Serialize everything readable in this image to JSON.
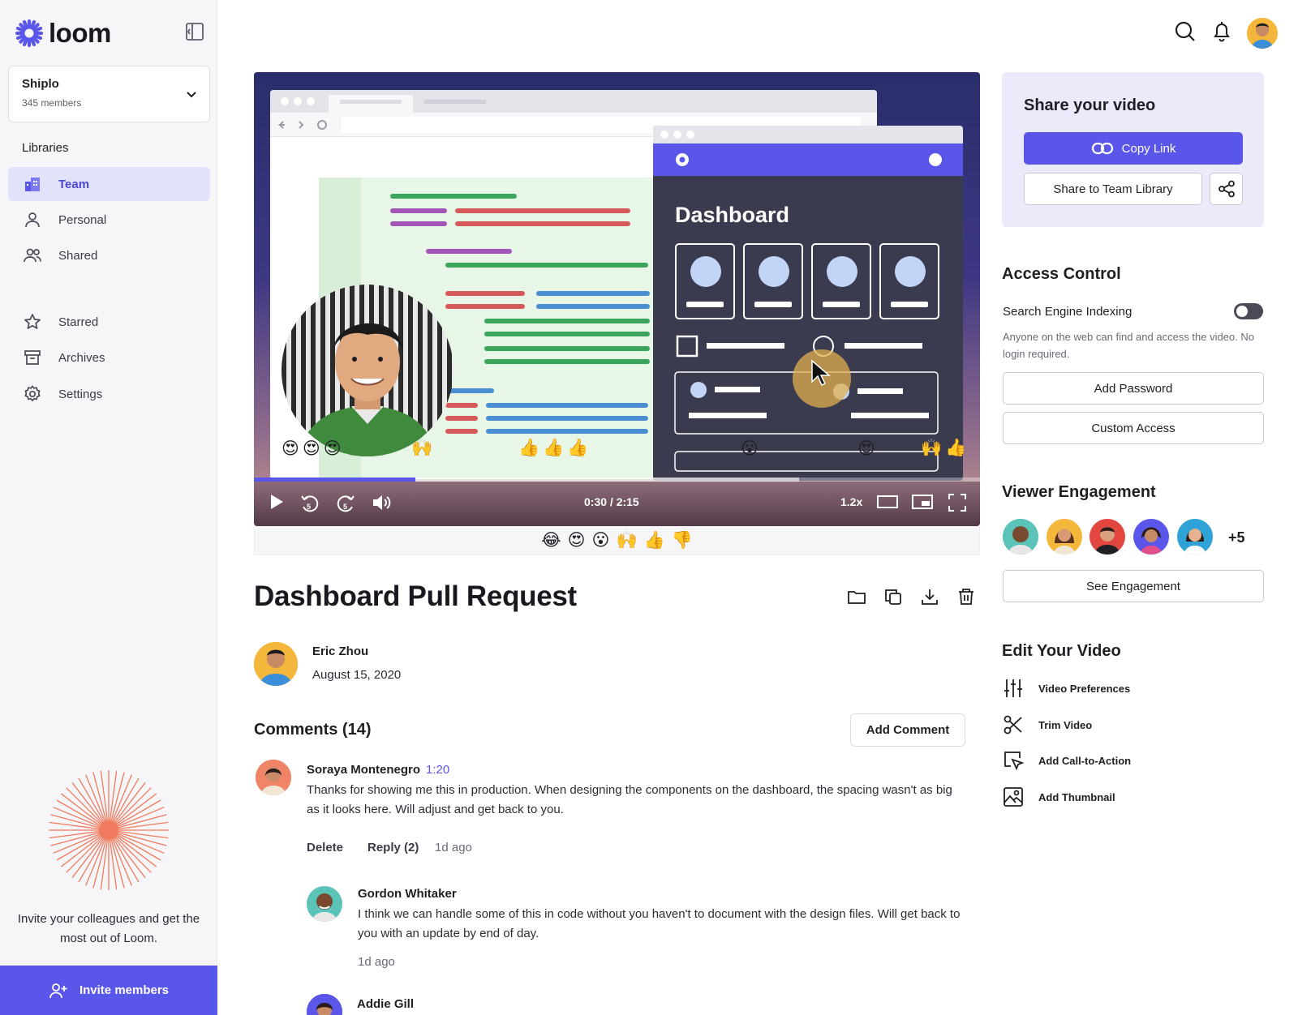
{
  "app": {
    "logo_text": "loom"
  },
  "workspace": {
    "name": "Shiplo",
    "members": "345 members"
  },
  "sidebar": {
    "libraries_heading": "Libraries",
    "items": [
      {
        "label": "Team",
        "icon": "team-icon",
        "active": true
      },
      {
        "label": "Personal",
        "icon": "person-icon",
        "active": false
      },
      {
        "label": "Shared",
        "icon": "people-icon",
        "active": false
      },
      {
        "label": "Starred",
        "icon": "star-icon",
        "active": false
      },
      {
        "label": "Archives",
        "icon": "archive-icon",
        "active": false
      },
      {
        "label": "Settings",
        "icon": "gear-icon",
        "active": false
      }
    ],
    "promo_text": "Invite your colleagues and get the most out of Loom.",
    "invite_label": "Invite members"
  },
  "video": {
    "current_time": "0:30",
    "duration": "2:15",
    "time_display": "0:30  /  2:15",
    "progress_fraction": 0.222,
    "speed": "1.2x",
    "screen_title": "Dashboard",
    "emojis_left": "😍😍😍",
    "emojis_mid": "🙌",
    "emojis_thumbs": "👍👍👍",
    "emojis_bar": "😮",
    "emojis_bar_right": "😍",
    "emojis_right": "🙌👍",
    "reactions": [
      "😂",
      "😍",
      "😮",
      "🙌",
      "👍",
      "👎"
    ]
  },
  "title": "Dashboard Pull Request",
  "author": {
    "name": "Eric Zhou",
    "date": "August 15, 2020"
  },
  "comments": {
    "heading": "Comments (14)",
    "add_label": "Add Comment",
    "items": [
      {
        "name": "Soraya Montenegro",
        "timestamp": "1:20",
        "body": "Thanks for showing me this in production. When designing the components on the dashboard, the spacing wasn't as big as it looks here. Will adjust and get back to you.",
        "delete_label": "Delete",
        "reply_label": "Reply (2)",
        "ago": "1d ago"
      },
      {
        "name": "Gordon Whitaker",
        "body": "I think we can handle some of this in code without you haven't to document with the design files. Will get back to you with an update by end of day.",
        "ago": "1d ago"
      },
      {
        "name": "Addie Gill"
      }
    ]
  },
  "share": {
    "title": "Share your video",
    "copy_link": "Copy Link",
    "share_team": "Share to Team Library"
  },
  "access": {
    "title": "Access Control",
    "seo_label": "Search Engine Indexing",
    "seo_enabled": false,
    "seo_desc": "Anyone on the web can find and access the video. No login required.",
    "add_password": "Add Password",
    "custom_access": "Custom Access"
  },
  "engagement": {
    "title": "Viewer Engagement",
    "more": "+5",
    "see_label": "See Engagement"
  },
  "edit": {
    "title": "Edit Your Video",
    "items": [
      {
        "label": "Video Preferences",
        "icon": "sliders-icon"
      },
      {
        "label": "Trim Video",
        "icon": "scissors-icon"
      },
      {
        "label": "Add Call-to-Action",
        "icon": "cursor-click-icon"
      },
      {
        "label": "Add Thumbnail",
        "icon": "image-icon"
      }
    ]
  },
  "colors": {
    "accent": "#5a56ea",
    "accent_light": "#e3e2fb",
    "share_card": "#eaeafb"
  }
}
